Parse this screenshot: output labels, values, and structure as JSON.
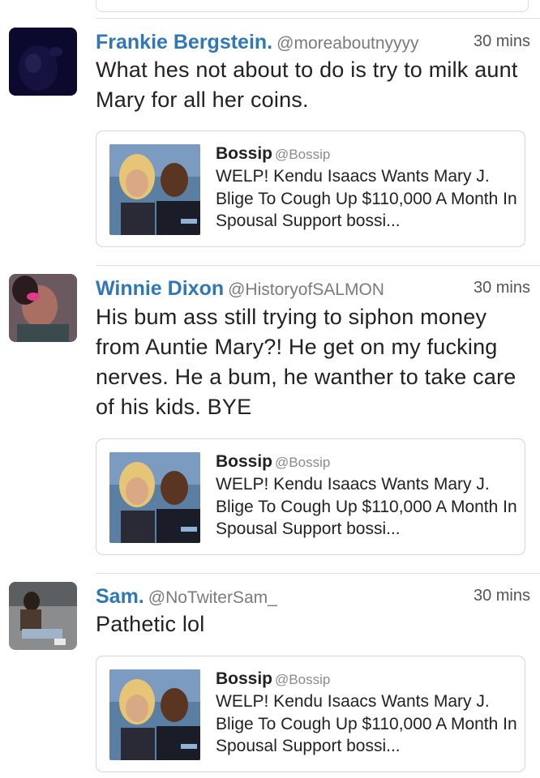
{
  "tweets": [
    {
      "name": "Frankie Bergstein.",
      "handle": "@moreaboutnyyyy",
      "time": "30 mins",
      "text": "What hes not about to do is try to milk aunt Mary for all her coins.",
      "card": {
        "source": "Bossip",
        "handle": "@Bossip",
        "description": "WELP! Kendu Isaacs Wants Mary J. Blige To Cough Up $110,000 A Month In Spousal Support bossi..."
      }
    },
    {
      "name": "Winnie Dixon",
      "handle": "@HistoryofSALMON",
      "time": "30 mins",
      "text": "His bum ass still trying to siphon money from Auntie Mary?! He get on my fucking nerves. He a bum, he wanther to take care of his kids. BYE",
      "card": {
        "source": "Bossip",
        "handle": "@Bossip",
        "description": "WELP! Kendu Isaacs Wants Mary J. Blige To Cough Up $110,000 A Month In Spousal Support bossi..."
      }
    },
    {
      "name": "Sam.",
      "handle": "@NoTwiterSam_",
      "time": "30 mins",
      "text": "Pathetic lol",
      "card": {
        "source": "Bossip",
        "handle": "@Bossip",
        "description": "WELP! Kendu Isaacs Wants Mary J. Blige To Cough Up $110,000 A Month In Spousal Support bossi..."
      }
    }
  ],
  "colors": {
    "name": "#2f77b5",
    "handle": "#7b7b7b",
    "divider": "#dedede",
    "card_border": "#d6d6d6"
  }
}
